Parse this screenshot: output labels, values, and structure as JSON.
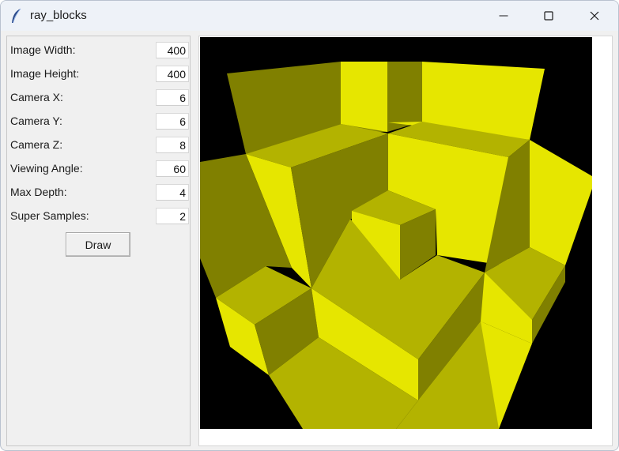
{
  "window": {
    "title": "ray_blocks",
    "app_icon": "feather-icon",
    "controls": [
      "minimize-icon",
      "maximize-icon",
      "close-icon"
    ]
  },
  "settings": {
    "fields": [
      {
        "label": "Image Width:",
        "value": "400"
      },
      {
        "label": "Image Height:",
        "value": "400"
      },
      {
        "label": "Camera X:",
        "value": "6"
      },
      {
        "label": "Camera Y:",
        "value": "6"
      },
      {
        "label": "Camera Z:",
        "value": "8"
      },
      {
        "label": "Viewing Angle:",
        "value": "60"
      },
      {
        "label": "Max Depth:",
        "value": "4"
      },
      {
        "label": "Super Samples:",
        "value": "2"
      }
    ],
    "draw_label": "Draw"
  },
  "render": {
    "background_color": "#000000",
    "face_colors": {
      "bright": "#e6e600",
      "medium": "#b3b300",
      "dark": "#808000"
    }
  }
}
